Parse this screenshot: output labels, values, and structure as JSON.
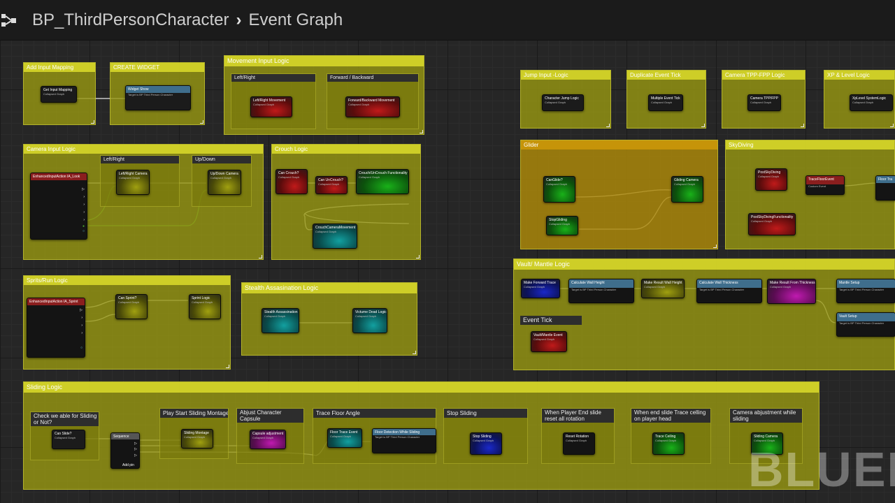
{
  "header": {
    "blueprint_name": "BP_ThirdPersonCharacter",
    "graph_name": "Event Graph"
  },
  "comments": {
    "add_input_mapping": "Add Input Mapping",
    "create_widget": "CREATE WIDGET",
    "movement_input_logic": "Movement Input Logic",
    "left_right": "Left/Right",
    "forward_backward": "Forward / Backward",
    "camera_input_logic": "Camera Input Logic",
    "cam_left_right": "Left/Right",
    "cam_up_down": "Up/Down",
    "crouch_logic": "Crouch Logic",
    "sprint_run_logic": "Sprits/Run Logic",
    "stealth_logic": "Stealth Assasination Logic",
    "jump_input_logic": "Jump Input -Logic",
    "duplicate_event_tick": "Duplicate Event Tick",
    "camera_tpp_fpp_logic": "Camera TPP-FPP Logic",
    "xp_level_logic": "XP & Level Logic",
    "glider": "Glider",
    "skydiving": "SkyDiving",
    "vault_mantle_logic": "Vault/ Mantle Logic",
    "event_tick": "Event Tick",
    "sliding_logic": "Sliding Logic",
    "check_sliding": "Check we able for Sliding or Not?",
    "play_start_sliding": "Play Start Sliding Montage",
    "adjust_capsule": "Abjust Character Capsule",
    "trace_floor_angle": "Trace Floor Angle",
    "stop_sliding": "Stop Sliding",
    "player_end_slide": "When Player End slide reset all rotation",
    "end_slide_trace": "When end slide Trace celling on player head",
    "camera_adjustment": "Camera abjustment while sliding"
  },
  "nodes": {
    "get_input_mapping": "Get Input Mapping",
    "widget_show": "Widget Show",
    "widget_show_target": "Target is BP Third Person Character",
    "left_right_movement": "Left/Right Movement",
    "forward_backward_movement": "Forward/Backward Movement",
    "enhanced_look": "EnhancedInputAction IA_Look",
    "left_right_camera": "Left/Right Camera",
    "up_down_camera": "Up/Down Camera",
    "can_crouch": "Can Crouch?",
    "can_uncrouch": "Can UnCrouch?",
    "crouch_functionality": "Crouch/UnCrouch Functionality",
    "crouch_camera_movement": "CrouchCameraMovement",
    "enhanced_sprint": "EnhancedInputAction IA_Sprint",
    "can_sprint": "Can Sprint?",
    "sprint_logic": "Sprint Logic",
    "stealth_assassination": "Stealth Assassination",
    "victume_dead_logic": "Victume Dead Logic",
    "character_jump_logic": "Character Jump Logic",
    "multiple_event_tick": "Multiple Event Tick",
    "camera_tpp_fpp": "Camera TPP/FPP",
    "xp_level_system": "XpLevel SystemLogic",
    "can_glide": "CanGlide?",
    "gliding_camera": "Gliding Camera",
    "stop_gliding": "StopGliding",
    "post_skydiving": "PostSkyDiving",
    "trace_floor_event": "TraceFloorEvent",
    "custom_event": "Custom Event",
    "post_skydiving_functionality": "PostSkyDivingFunctionality",
    "floor_trace_short": "Floor Tra",
    "make_forward_trace": "Make Forward Trace",
    "calculate_wall_height": "Calculate Wall Height",
    "bp_target": "Target is BP Third Person Character",
    "make_result_wall_height": "Make Result Wall Height",
    "calculate_wall_thickness": "Calculate Wall Thickness",
    "make_result_from_thickness": "Make Result From Thickness",
    "mantle_setup": "Mantle Setup",
    "vault_setup": "Vault Setup",
    "vault_mantle_event": "Vault/Mantle Event",
    "can_slide": "Can Slide?",
    "sequence": "Sequence",
    "add_pin": "Add pin",
    "sliding_montage": "Sliding Montage",
    "capsule_adjustment": "Capsule adjustment",
    "floor_trace_event": "Floor Trace Event",
    "floor_detection": "Floor Detection While Sliding",
    "stop_sliding_node": "Stop Sliding",
    "reset_rotation": "Reset Rotation",
    "trace_ceiling": "Trace Ceiling",
    "sliding_camera": "Sliding Camera",
    "collapsed_graph": "Collapsed Graph"
  },
  "watermark": "BLUEP",
  "colors": {
    "comment_fill": "#96961a",
    "comment_header": "#d2d228",
    "glider_header": "#c8960a",
    "background": "#262626"
  }
}
